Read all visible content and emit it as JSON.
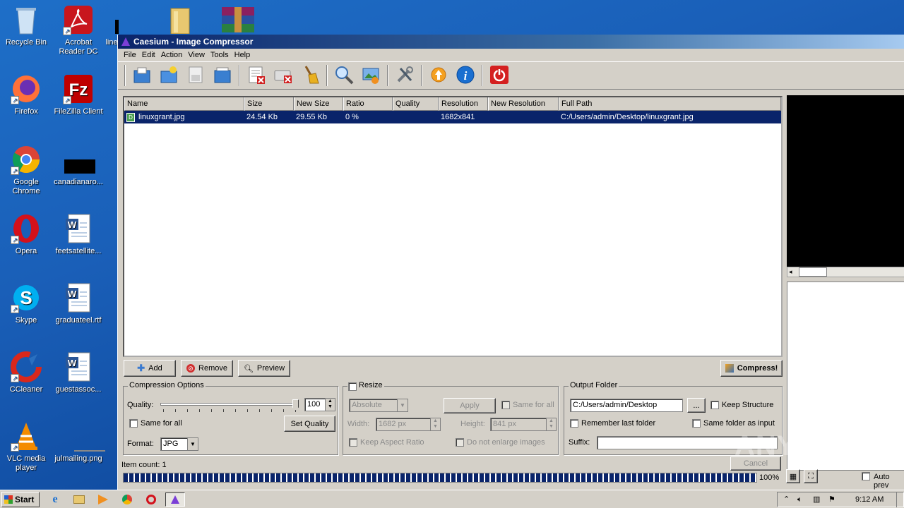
{
  "desktop": {
    "icons": [
      {
        "label": "Recycle Bin"
      },
      {
        "label": "Acrobat Reader DC"
      },
      {
        "label": "line"
      },
      {
        "label": "Firefox"
      },
      {
        "label": "FileZilla Client"
      },
      {
        "label": "Google Chrome"
      },
      {
        "label": "canadianaro..."
      },
      {
        "label": "Opera"
      },
      {
        "label": "feetsatellite..."
      },
      {
        "label": "Skype"
      },
      {
        "label": "graduateel.rtf"
      },
      {
        "label": "CCleaner"
      },
      {
        "label": "guestassoc..."
      },
      {
        "label": "VLC media player"
      },
      {
        "label": "julmailing.png"
      }
    ]
  },
  "window": {
    "title": "Caesium - Image Compressor",
    "menu": [
      "File",
      "Edit",
      "Action",
      "View",
      "Tools",
      "Help"
    ],
    "toolbar": [
      "open-folder",
      "new-folder",
      "save",
      "open",
      "remove-item",
      "clear-list",
      "clean",
      "search",
      "preview-image",
      "settings",
      "update",
      "about",
      "exit"
    ],
    "list": {
      "columns": [
        "Name",
        "Size",
        "New Size",
        "Ratio",
        "Quality",
        "Resolution",
        "New Resolution",
        "Full Path"
      ],
      "rows": [
        {
          "name": "linuxgrant.jpg",
          "size": "24.54 Kb",
          "new_size": "29.55 Kb",
          "ratio": "0 %",
          "quality": "",
          "resolution": "1682x841",
          "new_resolution": "",
          "path": "C:/Users/admin/Desktop/linuxgrant.jpg"
        }
      ]
    },
    "buttons": {
      "add": "Add",
      "remove": "Remove",
      "preview": "Preview",
      "compress": "Compress!"
    },
    "compression": {
      "title": "Compression Options",
      "quality_label": "Quality:",
      "quality_value": "100",
      "quality_level": 1.0,
      "same_for_all": "Same for all",
      "set_quality": "Set Quality",
      "format_label": "Format:",
      "format_value": "JPG"
    },
    "resize": {
      "title": "Resize",
      "mode": "Absolute",
      "apply": "Apply",
      "same_for_all": "Same for all",
      "width_label": "Width:",
      "width_value": "1682 px",
      "height_label": "Height:",
      "height_value": "841 px",
      "keep_aspect": "Keep Aspect Ratio",
      "no_enlarge": "Do not enlarge images"
    },
    "output": {
      "title": "Output Folder",
      "path": "C:/Users/admin/Desktop",
      "browse": "...",
      "keep_structure": "Keep Structure",
      "remember_last": "Remember last folder",
      "same_as_input": "Same folder as input",
      "suffix_label": "Suffix:",
      "suffix_value": ""
    },
    "status": {
      "item_count": "Item count: 1",
      "cancel": "Cancel",
      "progress_percent": "100%",
      "progress": 1.0,
      "auto_preview": "Auto prev"
    }
  },
  "taskbar": {
    "start": "Start",
    "time": "9:12 AM"
  },
  "watermark": "ANY.RUN"
}
